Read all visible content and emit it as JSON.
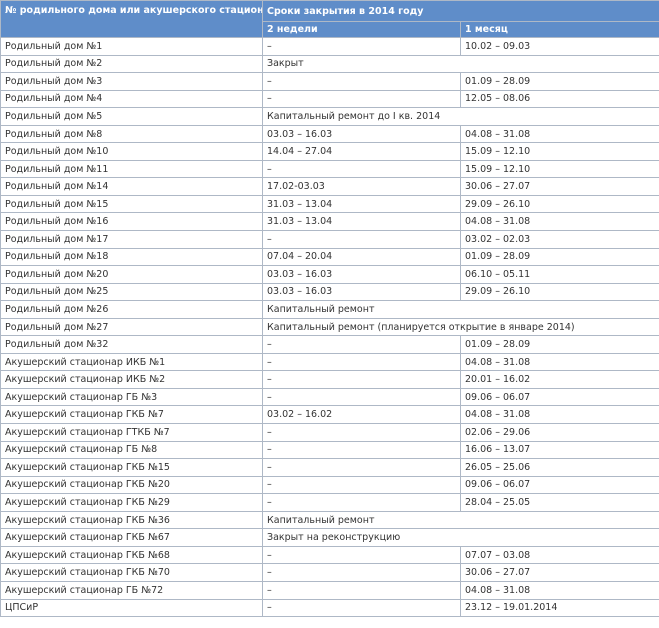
{
  "header": {
    "col_name": "№ родильного дома или акушерского стационара",
    "closure_group": "Сроки закрытия в 2014 году",
    "col_2weeks": "2 недели",
    "col_1month": "1 месяц"
  },
  "rows": [
    {
      "name": "Родильный дом №1",
      "weeks": "–",
      "month": "10.02 – 09.03"
    },
    {
      "name": "Родильный дом №2",
      "span": "Закрыт"
    },
    {
      "name": "Родильный дом №3",
      "weeks": "–",
      "month": "01.09 – 28.09"
    },
    {
      "name": "Родильный дом №4",
      "weeks": "–",
      "month": "12.05 – 08.06"
    },
    {
      "name": "Родильный дом №5",
      "span": "Капитальный ремонт до I кв. 2014"
    },
    {
      "name": "Родильный дом №8",
      "weeks": "03.03 – 16.03",
      "month": "04.08 – 31.08"
    },
    {
      "name": "Родильный дом №10",
      "weeks": "14.04 – 27.04",
      "month": "15.09 – 12.10"
    },
    {
      "name": "Родильный дом №11",
      "weeks": "–",
      "month": "15.09 – 12.10"
    },
    {
      "name": "Родильный дом №14",
      "weeks": "17.02-03.03",
      "month": "30.06 – 27.07"
    },
    {
      "name": "Родильный дом №15",
      "weeks": "31.03 – 13.04",
      "month": "29.09 – 26.10"
    },
    {
      "name": "Родильный дом №16",
      "weeks": "31.03 – 13.04",
      "month": "04.08 – 31.08"
    },
    {
      "name": "Родильный дом №17",
      "weeks": "–",
      "month": "03.02 – 02.03"
    },
    {
      "name": "Родильный дом №18",
      "weeks": "07.04 – 20.04",
      "month": "01.09 – 28.09"
    },
    {
      "name": "Родильный дом №20",
      "weeks": "03.03 – 16.03",
      "month": "06.10 – 05.11"
    },
    {
      "name": "Родильный дом №25",
      "weeks": "03.03 – 16.03",
      "month": "29.09 – 26.10"
    },
    {
      "name": "Родильный дом №26",
      "span": "Капитальный ремонт"
    },
    {
      "name": "Родильный дом №27",
      "span": "Капитальный ремонт (планируется открытие в январе 2014)"
    },
    {
      "name": "Родильный дом №32",
      "weeks": "–",
      "month": "01.09 – 28.09"
    },
    {
      "name": "Акушерский стационар ИКБ №1",
      "weeks": "–",
      "month": "04.08 – 31.08"
    },
    {
      "name": "Акушерский стационар ИКБ №2",
      "weeks": "–",
      "month": "20.01 – 16.02"
    },
    {
      "name": "Акушерский стационар ГБ №3",
      "weeks": "–",
      "month": "09.06 – 06.07"
    },
    {
      "name": "Акушерский стационар ГКБ №7",
      "weeks": "03.02 – 16.02",
      "month": "04.08 – 31.08"
    },
    {
      "name": "Акушерский стационар ГТКБ №7",
      "weeks": "–",
      "month": "02.06 – 29.06"
    },
    {
      "name": "Акушерский стационар ГБ №8",
      "weeks": "–",
      "month": "16.06 – 13.07"
    },
    {
      "name": "Акушерский стационар ГКБ №15",
      "weeks": "–",
      "month": "26.05 – 25.06"
    },
    {
      "name": "Акушерский стационар ГКБ №20",
      "weeks": "–",
      "month": "09.06 – 06.07"
    },
    {
      "name": "Акушерский стационар ГКБ №29",
      "weeks": "–",
      "month": "28.04 – 25.05"
    },
    {
      "name": "Акушерский стационар ГКБ №36",
      "span": "Капитальный ремонт"
    },
    {
      "name": "Акушерский стационар ГКБ №67",
      "span": "Закрыт на реконструкцию"
    },
    {
      "name": "Акушерский стационар ГКБ №68",
      "weeks": "–",
      "month": "07.07 – 03.08"
    },
    {
      "name": "Акушерский стационар ГКБ №70",
      "weeks": "–",
      "month": "30.06 – 27.07"
    },
    {
      "name": "Акушерский стационар ГБ №72",
      "weeks": "–",
      "month": "04.08 – 31.08"
    },
    {
      "name": "ЦПСиР",
      "weeks": "–",
      "month": "23.12 – 19.01.2014"
    }
  ]
}
